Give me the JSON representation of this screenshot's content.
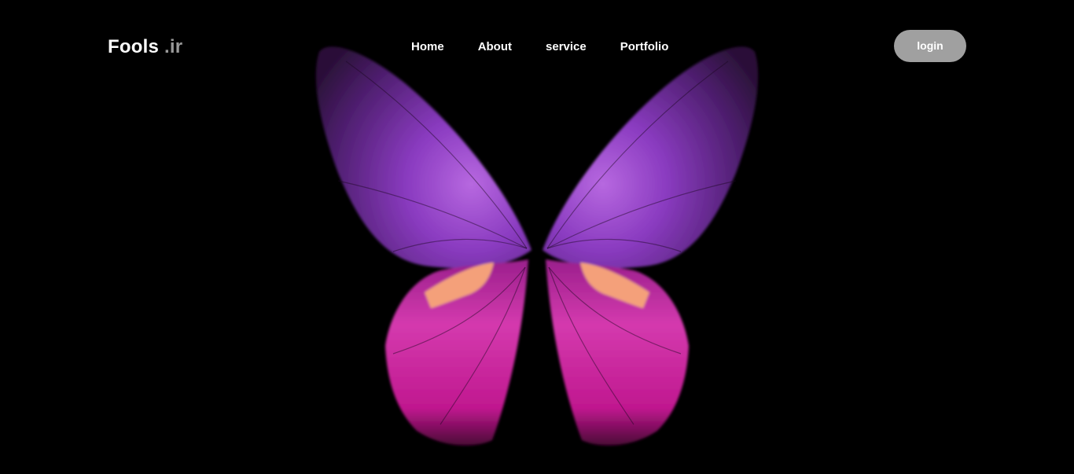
{
  "header": {
    "logo_name": "Fools",
    "logo_suffix": ".ir"
  },
  "nav": {
    "items": [
      "Home",
      "About",
      "service",
      "Portfolio"
    ]
  },
  "login": {
    "label": "login"
  },
  "hero": {
    "image_icon": "butterfly-icon",
    "colors": {
      "background": "#000000",
      "upper_wing": "#7a2fa8",
      "lower_wing": "#c8209a",
      "wing_spot": "#f4a07a",
      "login_button": "#a0a0a0"
    }
  }
}
